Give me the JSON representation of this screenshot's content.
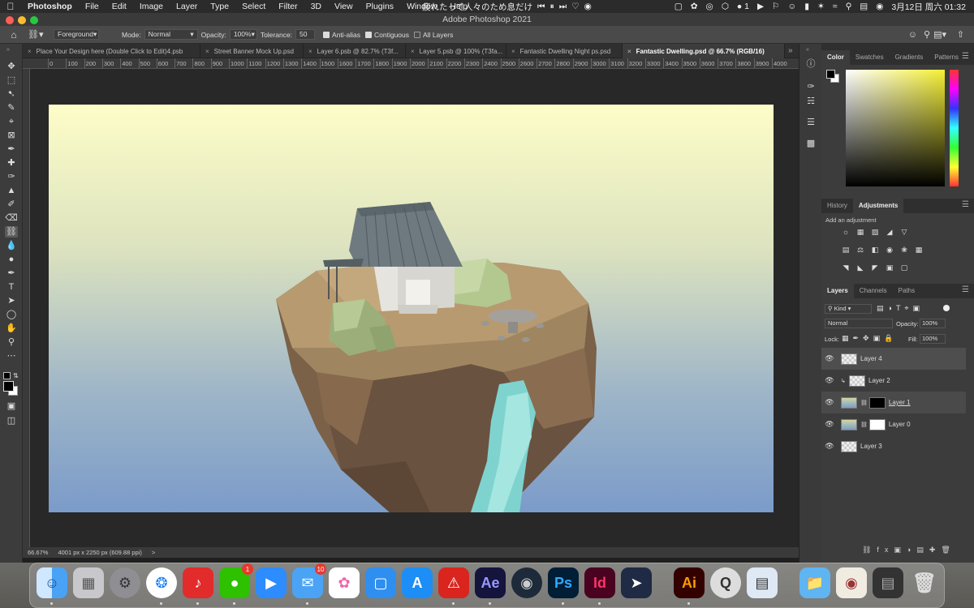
{
  "menubar": {
    "app": "Photoshop",
    "items": [
      "File",
      "Edit",
      "Image",
      "Layer",
      "Type",
      "Select",
      "Filter",
      "3D",
      "View",
      "Plugins",
      "Window",
      "Help"
    ],
    "now_playing": "疲れたって人々のため息だけ",
    "wechat_count": "1",
    "date_time": "3月12日 周六 01:32"
  },
  "window_title": "Adobe Photoshop 2021",
  "options": {
    "tool_preset": "Foreground",
    "mode_label": "Mode:",
    "mode_value": "Normal",
    "opacity_label": "Opacity:",
    "opacity_value": "100%",
    "tolerance_label": "Tolerance:",
    "tolerance_value": "50",
    "antialias_label": "Anti-alias",
    "contiguous_label": "Contiguous",
    "all_layers_label": "All Layers"
  },
  "tabs": [
    {
      "label": "Place Your Design here (Double Click to Edit)4.psb"
    },
    {
      "label": "Street Banner Mock Up.psd"
    },
    {
      "label": "Layer 6.psb @ 82.7% (T3f..."
    },
    {
      "label": "Layer 5.psb @ 100% (T3fa..."
    },
    {
      "label": "Fantastic Dwelling Night ps.psd"
    },
    {
      "label": "Fantastic Dwelling.psd @ 66.7% (RGB/16)"
    }
  ],
  "ruler_ticks": [
    "0",
    "100",
    "200",
    "300",
    "400",
    "500",
    "600",
    "700",
    "800",
    "900",
    "1000",
    "1100",
    "1200",
    "1300",
    "1400",
    "1500",
    "1600",
    "1700",
    "1800",
    "1900",
    "2000",
    "2100",
    "2200",
    "2300",
    "2400",
    "2500",
    "2600",
    "2700",
    "2800",
    "2900",
    "3000",
    "3100",
    "3200",
    "3300",
    "3400",
    "3500",
    "3600",
    "3700",
    "3800",
    "3900",
    "4000"
  ],
  "status": {
    "zoom": "66.67%",
    "doc_info": "4001 px x 2250 px (609.88 ppi)",
    "arrow": ">"
  },
  "panels": {
    "color_tabs": [
      "Color",
      "Swatches",
      "Gradients",
      "Patterns"
    ],
    "adjust_tabs": [
      "History",
      "Adjustments"
    ],
    "add_adjustment": "Add an adjustment",
    "layer_tabs": [
      "Layers",
      "Channels",
      "Paths"
    ],
    "kind_label": "Kind",
    "blend_mode": "Normal",
    "opacity_label": "Opacity:",
    "opacity_value": "100%",
    "lock_label": "Lock:",
    "fill_label": "Fill:",
    "fill_value": "100%",
    "layers": [
      {
        "name": "Layer 4"
      },
      {
        "name": "Layer 2"
      },
      {
        "name": "Layer 1"
      },
      {
        "name": "Layer 0"
      },
      {
        "name": "Layer 3"
      }
    ]
  },
  "dock": {
    "mail_badge": "10",
    "wechat_badge": "1",
    "apps": [
      "Finder",
      "Launchpad",
      "System Preferences",
      "Safari",
      "NetEase Music",
      "WeChat",
      "Zoom",
      "Mail",
      "Photos",
      "Keynote",
      "App Store",
      "Acrobat",
      "After Effects",
      "Cinema 4D",
      "Photoshop",
      "InDesign",
      "Desktop Switcher",
      "Illustrator",
      "QuickTime",
      "Preview",
      "Folder",
      "Photo",
      "Screenshot",
      "Trash"
    ],
    "labels": {
      "ae": "Ae",
      "ps": "Ps",
      "id": "Id",
      "ai": "Ai"
    }
  },
  "colors": {
    "accent": "#4a90d9",
    "canvas_top": "#fdfdc8",
    "canvas_bottom": "#7b9bc9"
  }
}
